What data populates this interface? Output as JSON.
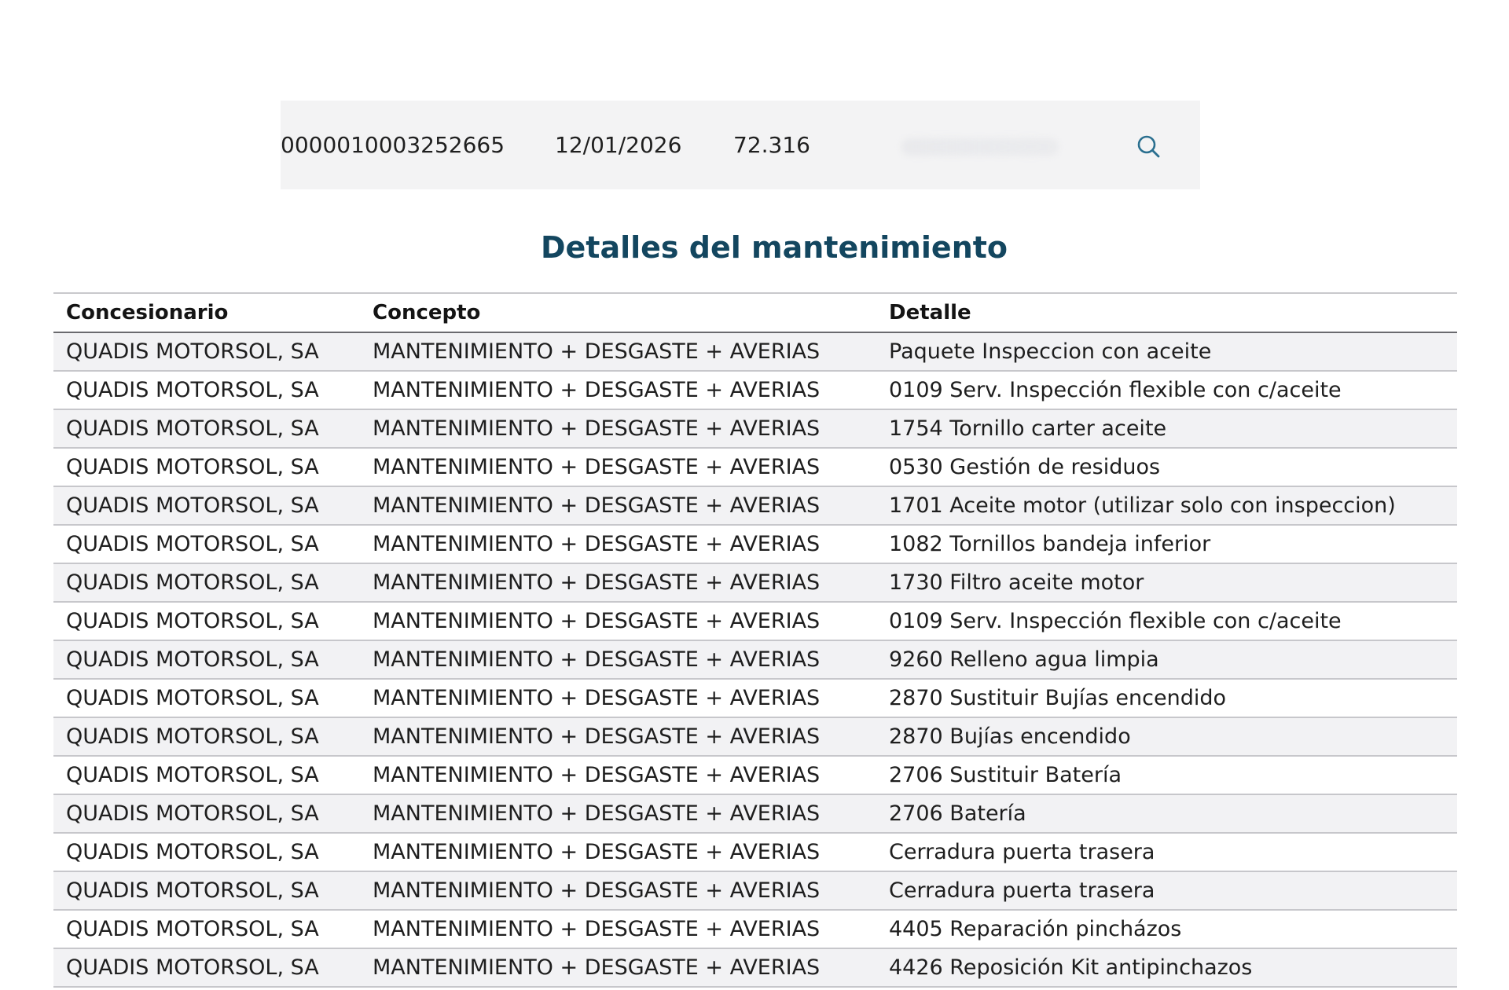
{
  "summary": {
    "number": "0000010003252665",
    "date": "12/01/2026",
    "km": "72.316"
  },
  "icons": {
    "search": "search-icon"
  },
  "colors": {
    "title": "#13465f",
    "search_icon": "#2a6f8f",
    "summary_bg": "#f3f3f4",
    "row_stripe": "#f2f2f4"
  },
  "section": {
    "title": "Detalles del mantenimiento"
  },
  "table": {
    "headers": {
      "concesionario": "Concesionario",
      "concepto": "Concepto",
      "detalle": "Detalle"
    },
    "rows": [
      {
        "concesionario": "QUADIS MOTORSOL, SA",
        "concepto": "MANTENIMIENTO + DESGASTE + AVERIAS",
        "detalle": "Paquete Inspeccion con aceite"
      },
      {
        "concesionario": "QUADIS MOTORSOL, SA",
        "concepto": "MANTENIMIENTO + DESGASTE + AVERIAS",
        "detalle": "0109 Serv. Inspección flexible con c/aceite"
      },
      {
        "concesionario": "QUADIS MOTORSOL, SA",
        "concepto": "MANTENIMIENTO + DESGASTE + AVERIAS",
        "detalle": "1754 Tornillo carter aceite"
      },
      {
        "concesionario": "QUADIS MOTORSOL, SA",
        "concepto": "MANTENIMIENTO + DESGASTE + AVERIAS",
        "detalle": "0530 Gestión de residuos"
      },
      {
        "concesionario": "QUADIS MOTORSOL, SA",
        "concepto": "MANTENIMIENTO + DESGASTE + AVERIAS",
        "detalle": "1701 Aceite motor (utilizar solo con inspeccion)"
      },
      {
        "concesionario": "QUADIS MOTORSOL, SA",
        "concepto": "MANTENIMIENTO + DESGASTE + AVERIAS",
        "detalle": "1082 Tornillos bandeja inferior"
      },
      {
        "concesionario": "QUADIS MOTORSOL, SA",
        "concepto": "MANTENIMIENTO + DESGASTE + AVERIAS",
        "detalle": "1730 Filtro aceite motor"
      },
      {
        "concesionario": "QUADIS MOTORSOL, SA",
        "concepto": "MANTENIMIENTO + DESGASTE + AVERIAS",
        "detalle": "0109 Serv. Inspección flexible con c/aceite"
      },
      {
        "concesionario": "QUADIS MOTORSOL, SA",
        "concepto": "MANTENIMIENTO + DESGASTE + AVERIAS",
        "detalle": "9260 Relleno agua limpia"
      },
      {
        "concesionario": "QUADIS MOTORSOL, SA",
        "concepto": "MANTENIMIENTO + DESGASTE + AVERIAS",
        "detalle": "2870 Sustituir Bujías encendido"
      },
      {
        "concesionario": "QUADIS MOTORSOL, SA",
        "concepto": "MANTENIMIENTO + DESGASTE + AVERIAS",
        "detalle": "2870 Bujías encendido"
      },
      {
        "concesionario": "QUADIS MOTORSOL, SA",
        "concepto": "MANTENIMIENTO + DESGASTE + AVERIAS",
        "detalle": "2706 Sustituir Batería"
      },
      {
        "concesionario": "QUADIS MOTORSOL, SA",
        "concepto": "MANTENIMIENTO + DESGASTE + AVERIAS",
        "detalle": "2706 Batería"
      },
      {
        "concesionario": "QUADIS MOTORSOL, SA",
        "concepto": "MANTENIMIENTO + DESGASTE + AVERIAS",
        "detalle": "Cerradura puerta trasera"
      },
      {
        "concesionario": "QUADIS MOTORSOL, SA",
        "concepto": "MANTENIMIENTO + DESGASTE + AVERIAS",
        "detalle": "Cerradura puerta trasera"
      },
      {
        "concesionario": "QUADIS MOTORSOL, SA",
        "concepto": "MANTENIMIENTO + DESGASTE + AVERIAS",
        "detalle": "4405 Reparación pincházos"
      },
      {
        "concesionario": "QUADIS MOTORSOL, SA",
        "concepto": "MANTENIMIENTO + DESGASTE + AVERIAS",
        "detalle": "4426 Reposición Kit antipinchazos"
      }
    ]
  }
}
